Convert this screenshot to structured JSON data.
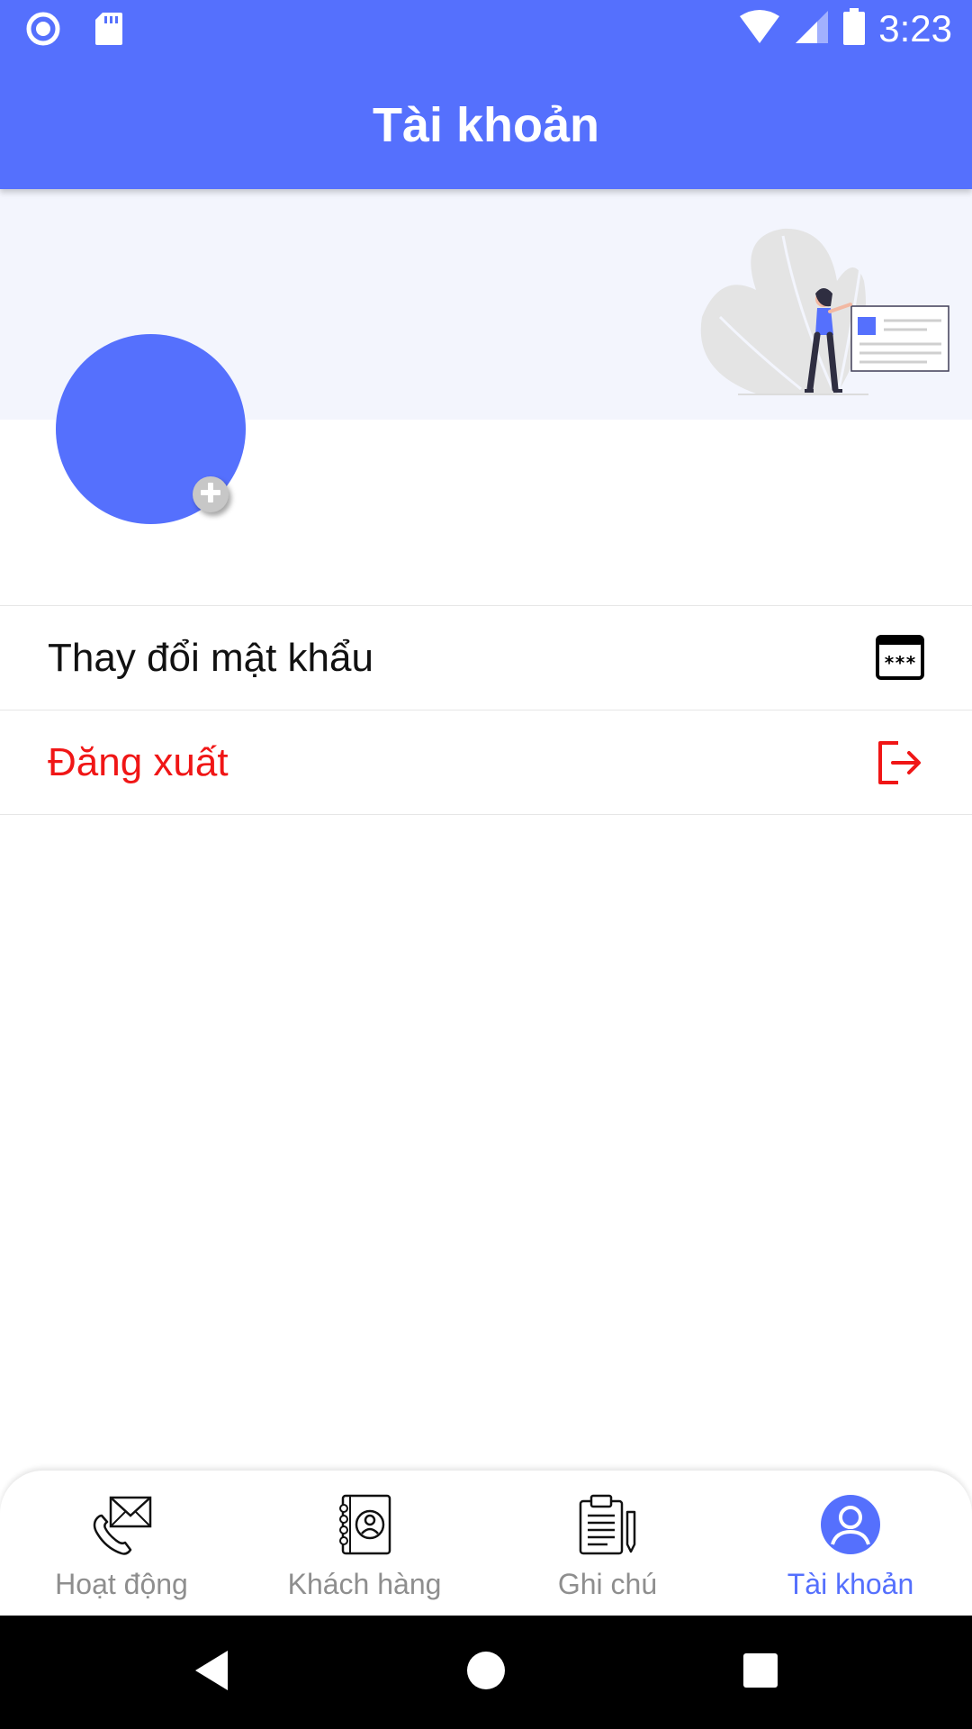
{
  "status_bar": {
    "time": "3:23",
    "left_icons": [
      "record-icon",
      "sd-card-icon"
    ],
    "right_icons": [
      "wifi-icon",
      "cellular-signal-icon",
      "battery-icon"
    ]
  },
  "header": {
    "title": "Tài khoản"
  },
  "profile": {
    "avatar_color": "#5570fd",
    "add_photo_icon": "plus-circle-icon",
    "banner_illustration": "woman-with-password-card-illustration"
  },
  "menu": {
    "items": [
      {
        "label": "Thay đổi mật khẩu",
        "icon": "password-icon"
      },
      {
        "label": "Đăng xuất",
        "icon": "logout-icon",
        "color": "#f01616"
      }
    ]
  },
  "bottom_nav": {
    "items": [
      {
        "label": "Hoạt động",
        "icon": "phone-mail-icon",
        "active": false
      },
      {
        "label": "Khách hàng",
        "icon": "contact-book-icon",
        "active": false
      },
      {
        "label": "Ghi chú",
        "icon": "clipboard-note-icon",
        "active": false
      },
      {
        "label": "Tài khoản",
        "icon": "user-account-icon",
        "active": true
      }
    ],
    "active_color": "#5570fd",
    "inactive_color": "#8e8e8e"
  },
  "system_nav": {
    "buttons": [
      "back-icon",
      "home-icon",
      "recents-icon"
    ]
  },
  "colors": {
    "primary": "#5570fd",
    "banner_bg": "#f3f5fd",
    "danger": "#f01616"
  }
}
